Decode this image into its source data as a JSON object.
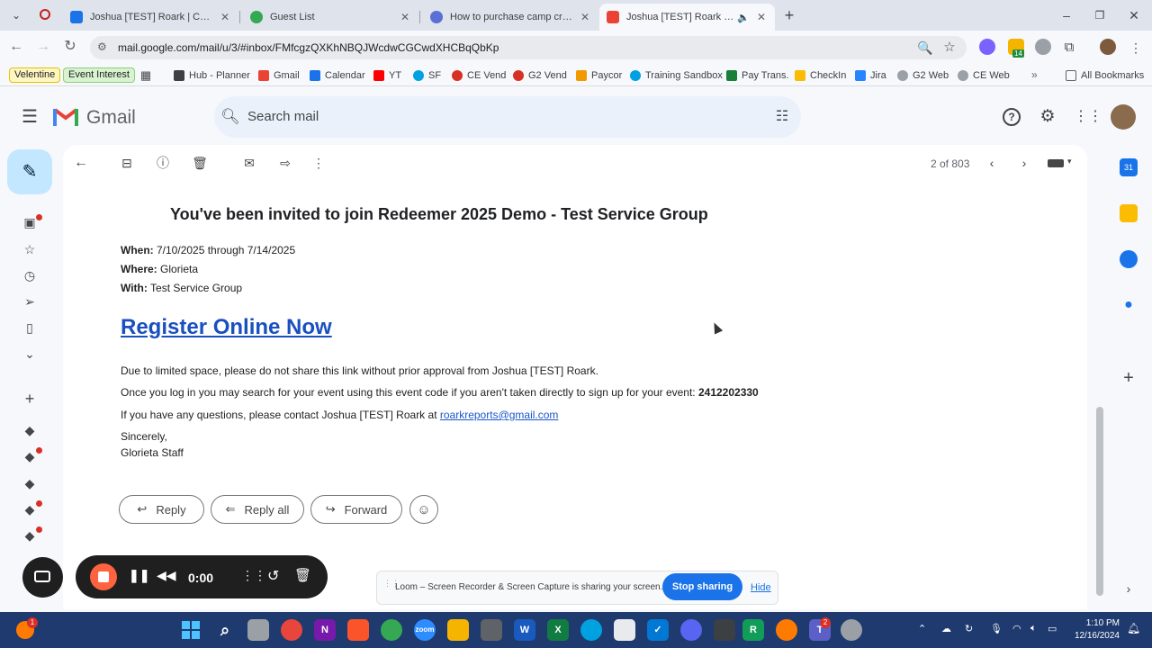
{
  "browser": {
    "tabs": [
      {
        "label": "Joshua [TEST] Roark | Contact I",
        "color": "#1a73e8"
      },
      {
        "label": "Guest List",
        "color": "#34a853"
      },
      {
        "label": "How to purchase camp credit f",
        "color": "#5b6fd6"
      },
      {
        "label": "Joshua [TEST] Roark invites",
        "color": "#ea4335"
      }
    ],
    "url": "mail.google.com/mail/u/3/#inbox/FMfcgzQXKhNBQJWcdwCGCwdXHCBqQbKp",
    "bookmarks": [
      "Velentine",
      "Event Interest",
      "Hub - Planner",
      "Gmail",
      "Calendar",
      "YT",
      "SF",
      "CE Vend",
      "G2 Vend",
      "Paycor",
      "Training Sandbox",
      "Pay Trans.",
      "CheckIn",
      "Jira",
      "G2 Web",
      "CE Web"
    ],
    "all_bookmarks": "All Bookmarks",
    "ext_badge": "14"
  },
  "gmail": {
    "logo_text": "Gmail",
    "search_placeholder": "Search mail",
    "pagination": "2 of 803"
  },
  "email": {
    "title": "You've been invited to join Redeemer 2025 Demo - Test Service Group",
    "when_label": "When:",
    "when_value": "7/10/2025 through 7/14/2025",
    "where_label": "Where:",
    "where_value": "Glorieta",
    "with_label": "With:",
    "with_value": "Test Service Group",
    "register_link": "Register Online Now",
    "para1": "Due to limited space, please do not share this link without prior approval from Joshua [TEST] Roark.",
    "para2": "Once you log in you may search for your event using this event code if you aren't taken directly to sign up for your event:",
    "event_code": "2412202330",
    "para3": "If you have any questions, please contact Joshua [TEST] Roark at",
    "contact_email": "roarkreports@gmail.com",
    "signoff": "Sincerely,",
    "signature": "Glorieta Staff"
  },
  "actions": {
    "reply": "Reply",
    "reply_all": "Reply all",
    "forward": "Forward"
  },
  "loom": {
    "timer": "0:00",
    "share_text": "Loom – Screen Recorder & Screen Capture is sharing your screen.",
    "stop": "Stop sharing",
    "hide": "Hide"
  },
  "taskbar": {
    "time": "1:10 PM",
    "date": "12/16/2024",
    "teams_badge": "2",
    "notif_badge": "1"
  }
}
